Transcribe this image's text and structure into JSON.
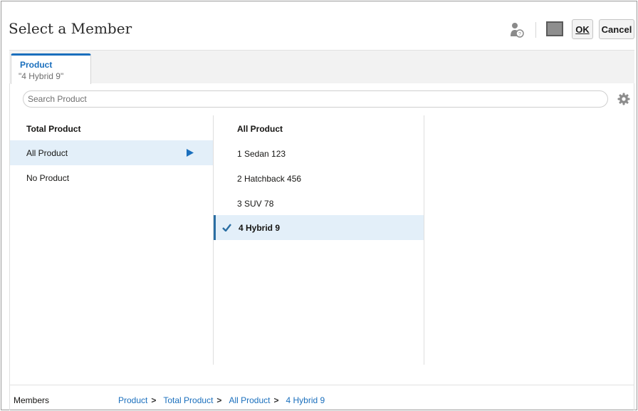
{
  "dialog": {
    "title": "Select a Member",
    "ok_label": "OK",
    "cancel_label": "Cancel"
  },
  "tab": {
    "title": "Product",
    "subtitle": "\"4 Hybrid 9\""
  },
  "search": {
    "placeholder": "Search Product"
  },
  "columns": [
    {
      "header": "Total Product",
      "items": [
        "All Product",
        "No Product"
      ]
    },
    {
      "header": "All Product",
      "items": [
        "1 Sedan 123",
        "2 Hatchback 456",
        "3 SUV 78",
        "4 Hybrid 9"
      ]
    }
  ],
  "footer": {
    "label": "Members",
    "breadcrumb": [
      "Product",
      "Total Product",
      "All Product",
      "4 Hybrid 9"
    ],
    "separator": ">"
  },
  "colors": {
    "accent": "#1a6fbd",
    "selected_row": "#e3eff9"
  },
  "icons": [
    "member-properties-icon",
    "square-icon",
    "gear-icon",
    "arrow-right-icon",
    "check-icon"
  ]
}
